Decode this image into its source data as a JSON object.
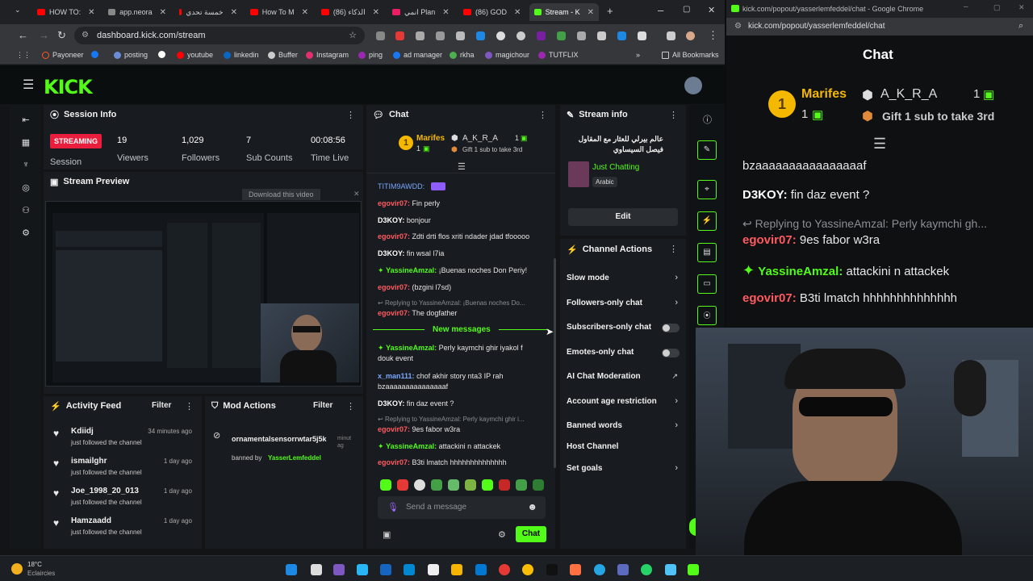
{
  "browser": {
    "tabs": [
      {
        "label": "HOW TO: ",
        "color": "#ff0000"
      },
      {
        "label": "app.neora",
        "color": "#888888"
      },
      {
        "label": "خمسة تحدي",
        "color": "#ff0000"
      },
      {
        "label": "How To M",
        "color": "#ff0000"
      },
      {
        "label": "الذكاء (86)",
        "color": "#ff0000"
      },
      {
        "label": "انمي Plan",
        "color": "#e91e63"
      },
      {
        "label": "(86) GOD",
        "color": "#ff0000"
      },
      {
        "label": "Stream - K",
        "color": "#53fc18"
      }
    ],
    "url": "dashboard.kick.com/stream",
    "bookmarks": [
      "Payoneer",
      "posting",
      "youtube",
      "linkedin",
      "Buffer",
      "Instagram",
      "ping",
      "ad manager",
      "rkha",
      "magichour",
      "TUTFLIX"
    ],
    "all_bookmarks": "All Bookmarks"
  },
  "session": {
    "title": "Session Info",
    "status": "STREAMING",
    "session_label": "Session",
    "stats": [
      {
        "value": "19",
        "label": "Viewers"
      },
      {
        "value": "1,029",
        "label": "Followers"
      },
      {
        "value": "7",
        "label": "Sub Counts"
      },
      {
        "value": "00:08:56",
        "label": "Time Live"
      }
    ]
  },
  "preview": {
    "title": "Stream Preview",
    "download": "Download this video"
  },
  "activity": {
    "title": "Activity Feed",
    "filter": "Filter",
    "items": [
      {
        "name": "Kdiidj",
        "sub": "just followed the channel",
        "time": "34 minutes ago"
      },
      {
        "name": "ismailghr",
        "sub": "just followed the channel",
        "time": "1 day ago"
      },
      {
        "name": "Joe_1998_20_013",
        "sub": "just followed the channel",
        "time": "1 day ago"
      },
      {
        "name": "Hamzaadd",
        "sub": "just followed the channel",
        "time": "1 day ago"
      }
    ]
  },
  "mod": {
    "title": "Mod Actions",
    "filter": "Filter",
    "user": "ornamentalsensorrwtar5j5k",
    "time": "minut ag",
    "banned_by": "banned by",
    "moderator": "YasserLemfeddel"
  },
  "chat": {
    "title": "Chat",
    "leader1": "Marifes",
    "leader1_count": "1",
    "leader2": "A_K_R_A",
    "leader2_count": "1",
    "gift_text": "Gift 1 sub to take 3rd",
    "top_user": "TITIM9AWDD:",
    "messages": [
      {
        "user": "egovir07:",
        "text": "Fin perly",
        "color": "#ff5a5f"
      },
      {
        "user": "D3KOY:",
        "text": "bonjour",
        "color": "#ffffff"
      },
      {
        "user": "egovir07:",
        "text": "Zdti drti flos xriti ndader jdad tfooooo",
        "color": "#ff5a5f"
      },
      {
        "user": "D3KOY:",
        "text": "fin wsal l7ia",
        "color": "#ffffff"
      },
      {
        "user": "YassineAmzal:",
        "text": "¡Buenas noches Don Periy!",
        "color": "#53fc18"
      }
    ],
    "msg_bzgini": {
      "user": "egovir07:",
      "text": "(bzgini l7sd)"
    },
    "reply1": "Replying to YassineAmzal: ¡Buenas noches Do...",
    "msg_dogfather": {
      "user": "egovir07:",
      "text": "The dogfather"
    },
    "new_messages": "New messages",
    "msg_perly": {
      "user": "YassineAmzal:",
      "text": "Perly kaymchi ghir iyakol f",
      "text2": "douk event"
    },
    "msg_man": {
      "user": "x_man111:",
      "text": "chof akhir story nta3 IP rah",
      "text2": "bzaaaaaaaaaaaaaaaf"
    },
    "msg_fin": {
      "user": "D3KOY:",
      "text": "fin daz event ?"
    },
    "reply2": "Replying to YassineAmzal: Perly kaymchi ghir i...",
    "msg_9es": {
      "user": "egovir07:",
      "text": "9es fabor w3ra"
    },
    "msg_attack": {
      "user": "YassineAmzal:",
      "text": "attackini n attackek"
    },
    "msg_b3ti": {
      "user": "egovir07:",
      "text": "B3ti lmatch hhhhhhhhhhhhhh"
    },
    "input_placeholder": "Send a message",
    "send": "Chat"
  },
  "stream_info": {
    "title": "Stream info",
    "stream_title": "عالم بيرلي للعثار مع المقاول فيصل السيساوي",
    "category": "Just Chatting",
    "language": "Arabic",
    "edit": "Edit"
  },
  "channel_actions": {
    "title": "Channel Actions",
    "slow": "Slow mode",
    "followers": "Followers-only chat",
    "subs": "Subscribers-only chat",
    "emotes": "Emotes-only chat",
    "ai": "AI Chat Moderation",
    "age": "Account age restriction",
    "banned": "Banned words",
    "host": "Host Channel",
    "goals": "Set goals"
  },
  "popout": {
    "window_title": "kick.com/popout/yasserlemfeddel/chat - Google Chrome",
    "url": "kick.com/popout/yasserlemfeddel/chat",
    "title": "Chat",
    "leader1": "Marifes",
    "leader1_count": "1",
    "leader2": "A_K_R_A",
    "leader2_count": "1",
    "gift_text": "Gift 1 sub to take 3rd",
    "line_bz": "bzaaaaaaaaaaaaaaaaf",
    "msg_fin": {
      "user": "D3KOY:",
      "text": "fin daz event ?"
    },
    "reply": "Replying to YassineAmzal: Perly kaymchi gh...",
    "msg_9es": {
      "user": "egovir07:",
      "text": "9es fabor w3ra"
    },
    "msg_attack": {
      "user": "YassineAmzal:",
      "text": "attackini n attackek"
    },
    "msg_b3ti": {
      "user": "egovir07:",
      "text": "B3ti lmatch hhhhhhhhhhhhhh"
    }
  },
  "taskbar": {
    "temp": "18°C",
    "weather": "Eclaircies"
  }
}
